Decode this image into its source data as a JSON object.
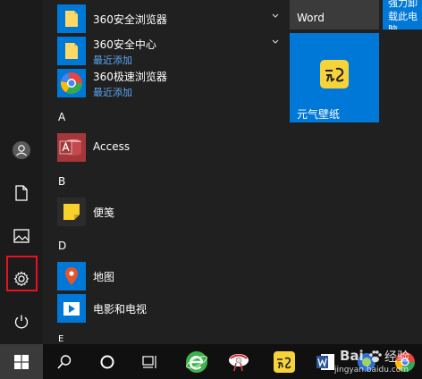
{
  "start_menu": {
    "rail": {
      "items": [
        {
          "name": "user",
          "icon": "user-avatar-icon"
        },
        {
          "name": "documents",
          "icon": "document-icon"
        },
        {
          "name": "pictures",
          "icon": "picture-icon"
        },
        {
          "name": "settings",
          "icon": "gear-icon",
          "highlighted": true
        },
        {
          "name": "power",
          "icon": "power-icon"
        }
      ],
      "highlight_color": "#e81123"
    },
    "apps": [
      {
        "label": "360安全浏览器",
        "sub": "",
        "icon": "folder-icon",
        "expandable": true
      },
      {
        "label": "360安全中心",
        "sub": "最近添加",
        "icon": "folder-icon",
        "expandable": true
      },
      {
        "label": "360极速浏览器",
        "sub": "最近添加",
        "icon": "chrome-like-icon",
        "expandable": false
      },
      {
        "label": "Access",
        "sub": "",
        "icon": "access-icon",
        "expandable": false
      },
      {
        "label": "便笺",
        "sub": "",
        "icon": "sticky-notes-icon",
        "expandable": false
      },
      {
        "label": "地图",
        "sub": "",
        "icon": "maps-icon",
        "expandable": false
      },
      {
        "label": "电影和电视",
        "sub": "",
        "icon": "movies-tv-icon",
        "expandable": false
      }
    ],
    "section_letters": [
      "A",
      "B",
      "D",
      "E"
    ],
    "tiles": {
      "word_label": "Word",
      "wallpaper_label": "元气壁纸",
      "partial_label": "强力卸载此电脑"
    }
  },
  "taskbar": {
    "items": [
      "start-icon",
      "search-icon",
      "cortana-icon",
      "task-view-icon",
      "browser-e-icon",
      "app-icon",
      "yuanqi-icon",
      "word-icon",
      "photo-icon",
      "chrome-icon"
    ]
  },
  "watermark": {
    "brand": "Bai",
    "paw": "du",
    "suffix": "经验",
    "url": "jingyan.baidu.com"
  },
  "colors": {
    "accent": "#0078d7",
    "link": "#5ba7f2",
    "tile_word": "#3b3b3b"
  }
}
